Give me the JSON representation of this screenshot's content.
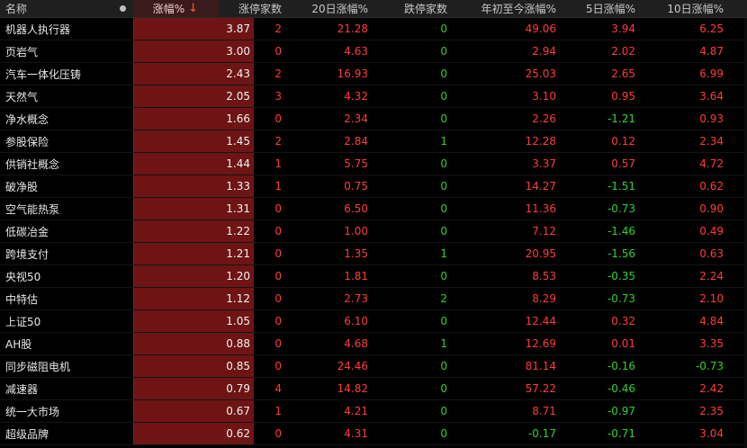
{
  "colors": {
    "up": "#ff3b3b",
    "down": "#2fd12f",
    "neutral": "#f2f2f2",
    "highlight_bg": "#6e1414"
  },
  "header": {
    "name": "名称",
    "dot": "dot-icon",
    "change_pct": "涨幅%",
    "sort_arrow": "↓",
    "limit_up_count": "涨停家数",
    "change_20d": "20日涨幅%",
    "limit_down_count": "跌停家数",
    "change_ytd": "年初至今涨幅%",
    "change_5d": "5日涨幅%",
    "change_10d": "10日涨幅%"
  },
  "rows": [
    {
      "name": "机器人执行器",
      "change_pct": "3.87",
      "limit_up": "2",
      "change_20d": "21.28",
      "limit_down": "0",
      "ytd": "49.06",
      "d5": "3.94",
      "d10": "6.25"
    },
    {
      "name": "页岩气",
      "change_pct": "3.00",
      "limit_up": "0",
      "change_20d": "4.63",
      "limit_down": "0",
      "ytd": "2.94",
      "d5": "2.02",
      "d10": "4.87"
    },
    {
      "name": "汽车一体化压铸",
      "change_pct": "2.43",
      "limit_up": "2",
      "change_20d": "16.93",
      "limit_down": "0",
      "ytd": "25.03",
      "d5": "2.65",
      "d10": "6.99"
    },
    {
      "name": "天然气",
      "change_pct": "2.05",
      "limit_up": "3",
      "change_20d": "4.32",
      "limit_down": "0",
      "ytd": "3.10",
      "d5": "0.95",
      "d10": "3.64"
    },
    {
      "name": "净水概念",
      "change_pct": "1.66",
      "limit_up": "0",
      "change_20d": "2.34",
      "limit_down": "0",
      "ytd": "2.26",
      "d5": "-1.21",
      "d10": "0.93"
    },
    {
      "name": "参股保险",
      "change_pct": "1.45",
      "limit_up": "2",
      "change_20d": "2.84",
      "limit_down": "1",
      "ytd": "12.28",
      "d5": "0.12",
      "d10": "2.34"
    },
    {
      "name": "供销社概念",
      "change_pct": "1.44",
      "limit_up": "1",
      "change_20d": "5.75",
      "limit_down": "0",
      "ytd": "3.37",
      "d5": "0.57",
      "d10": "4.72"
    },
    {
      "name": "破净股",
      "change_pct": "1.33",
      "limit_up": "1",
      "change_20d": "0.75",
      "limit_down": "0",
      "ytd": "14.27",
      "d5": "-1.51",
      "d10": "0.62"
    },
    {
      "name": "空气能热泵",
      "change_pct": "1.31",
      "limit_up": "0",
      "change_20d": "6.50",
      "limit_down": "0",
      "ytd": "11.36",
      "d5": "-0.73",
      "d10": "0.90"
    },
    {
      "name": "低碳冶金",
      "change_pct": "1.22",
      "limit_up": "0",
      "change_20d": "1.00",
      "limit_down": "0",
      "ytd": "7.12",
      "d5": "-1.46",
      "d10": "0.49"
    },
    {
      "name": "跨境支付",
      "change_pct": "1.21",
      "limit_up": "0",
      "change_20d": "1.35",
      "limit_down": "1",
      "ytd": "20.95",
      "d5": "-1.56",
      "d10": "0.63"
    },
    {
      "name": "央视50",
      "change_pct": "1.20",
      "limit_up": "0",
      "change_20d": "1.81",
      "limit_down": "0",
      "ytd": "8.53",
      "d5": "-0.35",
      "d10": "2.24"
    },
    {
      "name": "中特估",
      "change_pct": "1.12",
      "limit_up": "0",
      "change_20d": "2.73",
      "limit_down": "2",
      "ytd": "8.29",
      "d5": "-0.73",
      "d10": "2.10"
    },
    {
      "name": "上证50",
      "change_pct": "1.05",
      "limit_up": "0",
      "change_20d": "6.10",
      "limit_down": "0",
      "ytd": "12.44",
      "d5": "0.32",
      "d10": "4.84"
    },
    {
      "name": "AH股",
      "change_pct": "0.88",
      "limit_up": "0",
      "change_20d": "4.68",
      "limit_down": "1",
      "ytd": "12.69",
      "d5": "0.01",
      "d10": "3.35"
    },
    {
      "name": "同步磁阻电机",
      "change_pct": "0.85",
      "limit_up": "0",
      "change_20d": "24.46",
      "limit_down": "0",
      "ytd": "81.14",
      "d5": "-0.16",
      "d10": "-0.73"
    },
    {
      "name": "减速器",
      "change_pct": "0.79",
      "limit_up": "4",
      "change_20d": "14.82",
      "limit_down": "0",
      "ytd": "57.22",
      "d5": "-0.46",
      "d10": "2.42"
    },
    {
      "name": "统一大市场",
      "change_pct": "0.67",
      "limit_up": "1",
      "change_20d": "4.21",
      "limit_down": "0",
      "ytd": "8.71",
      "d5": "-0.97",
      "d10": "2.35"
    },
    {
      "name": "超级品牌",
      "change_pct": "0.62",
      "limit_up": "0",
      "change_20d": "4.31",
      "limit_down": "0",
      "ytd": "-0.17",
      "d5": "-0.71",
      "d10": "3.04"
    }
  ]
}
